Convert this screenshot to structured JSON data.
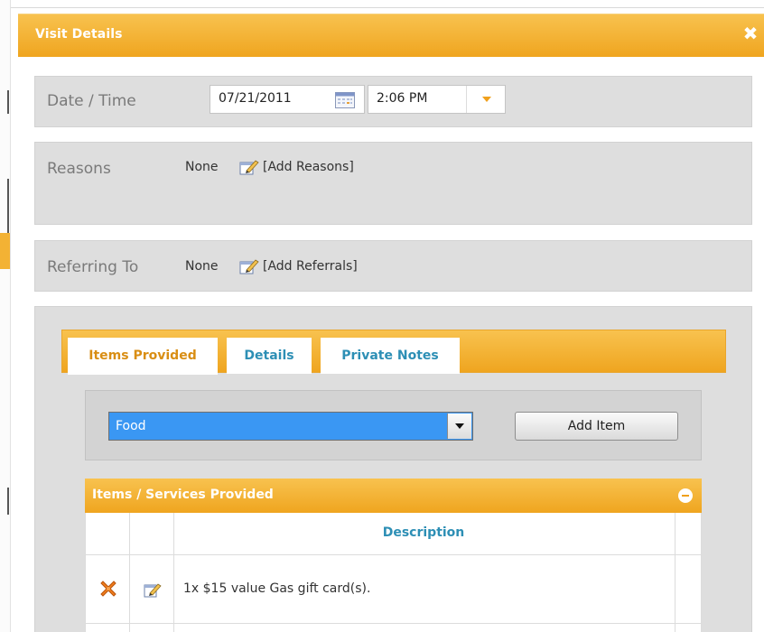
{
  "dialog": {
    "title": "Visit Details",
    "close_glyph": "✖"
  },
  "date_time": {
    "label": "Date / Time",
    "date": "07/21/2011",
    "time": "2:06 PM",
    "calendar_icon": "calendar-icon",
    "time_dropdown_icon": "caret-down-icon"
  },
  "reasons": {
    "label": "Reasons",
    "value": "None",
    "add_link": "[Add Reasons]",
    "icon": "edit-icon"
  },
  "referrals": {
    "label": "Referring To",
    "value": "None",
    "add_link": "[Add Referrals]",
    "icon": "edit-icon"
  },
  "tabs": [
    {
      "label": "Items Provided",
      "active": true
    },
    {
      "label": "Details",
      "active": false
    },
    {
      "label": "Private Notes",
      "active": false
    }
  ],
  "add_item": {
    "selected": "Food",
    "button_label": "Add Item"
  },
  "items_grid": {
    "title": "Items / Services Provided",
    "columns": [
      "",
      "",
      "Description"
    ],
    "rows": [
      {
        "description": "1x $15 value Gas gift card(s).",
        "delete_icon": "delete-x-icon",
        "edit_icon": "edit-icon"
      }
    ]
  },
  "colors": {
    "accent_orange": "#f0a01c",
    "link_blue": "#2d8fb5",
    "panel_gray": "#dedede",
    "select_blue": "#3a97f3"
  }
}
